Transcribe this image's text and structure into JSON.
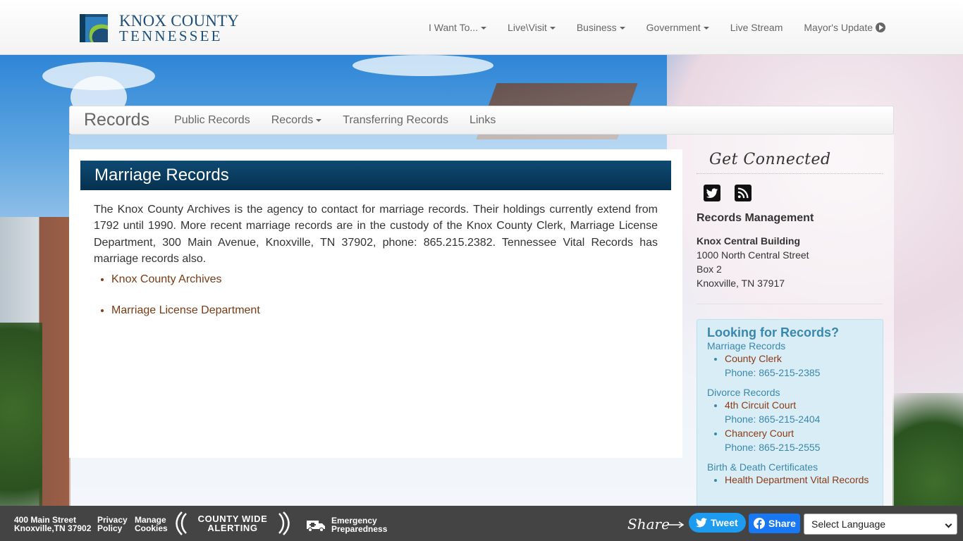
{
  "header": {
    "logo_line1": "KNOX COUNTY",
    "logo_line2": "TENNESSEE",
    "nav": [
      {
        "label": "I Want To..."
      },
      {
        "label": "Live\\Visit"
      },
      {
        "label": "Business"
      },
      {
        "label": "Government"
      },
      {
        "label": "Live Stream"
      },
      {
        "label": "Mayor's Update"
      }
    ]
  },
  "subnav": {
    "brand": "Records",
    "items": [
      {
        "label": "Public Records"
      },
      {
        "label": "Records"
      },
      {
        "label": "Transferring Records"
      },
      {
        "label": "Links"
      }
    ]
  },
  "main": {
    "title": "Marriage Records",
    "intro": "The Knox County Archives is the agency to contact for marriage records. Their holdings currently extend from 1792 until 1990. More recent marriage records are in the custody of the Knox County Clerk, Marriage License Department, 300 Main Avenue, Knoxville, TN 37902, phone: 865.215.2382. Tennessee Vital Records has marriage records also.",
    "links": [
      {
        "label": "Knox County Archives"
      },
      {
        "label": "Marriage License Department"
      }
    ]
  },
  "sidebar": {
    "get_connected": "Get Connected",
    "section_title": "Records Management",
    "address": {
      "building": "Knox Central Building",
      "street": "1000 North Central Street",
      "box": "Box 2",
      "city": "Knoxville, TN 37917"
    },
    "looking": {
      "heading": "Looking for Records?",
      "groups": [
        {
          "category": "Marriage Records",
          "items": [
            {
              "name": "County Clerk",
              "phone": "Phone: 865-215-2385"
            }
          ]
        },
        {
          "category": "Divorce Records",
          "items": [
            {
              "name": "4th Circuit Court",
              "phone": "Phone: 865-215-2404"
            },
            {
              "name": "Chancery Court",
              "phone": "Phone: 865-215-2555"
            }
          ]
        },
        {
          "category": "Birth & Death Certificates",
          "items": [
            {
              "name": "Health Department Vital Records",
              "phone": ""
            }
          ]
        }
      ]
    }
  },
  "footer": {
    "addr_line1": "400 Main Street",
    "addr_line2": "Knoxville,TN 37902",
    "privacy_line1": "Privacy",
    "privacy_line2": "Policy",
    "cookies_line1": "Manage",
    "cookies_line2": "Cookies",
    "alerting_line1": "COUNTY WIDE",
    "alerting_line2": "ALERTING",
    "emergency_line1": "Emergency",
    "emergency_line2": "Preparedness",
    "share_label": "Share",
    "tweet_label": "Tweet",
    "fb_label": "Share",
    "language_select": "Select Language"
  },
  "colors": {
    "title_bar": "#0e4a73",
    "link": "#8b3a14",
    "info_box": "#d9edf7",
    "info_text": "#3a87ad",
    "footer": "#444444",
    "twitter": "#1d9bf0",
    "facebook": "#1877f2"
  }
}
